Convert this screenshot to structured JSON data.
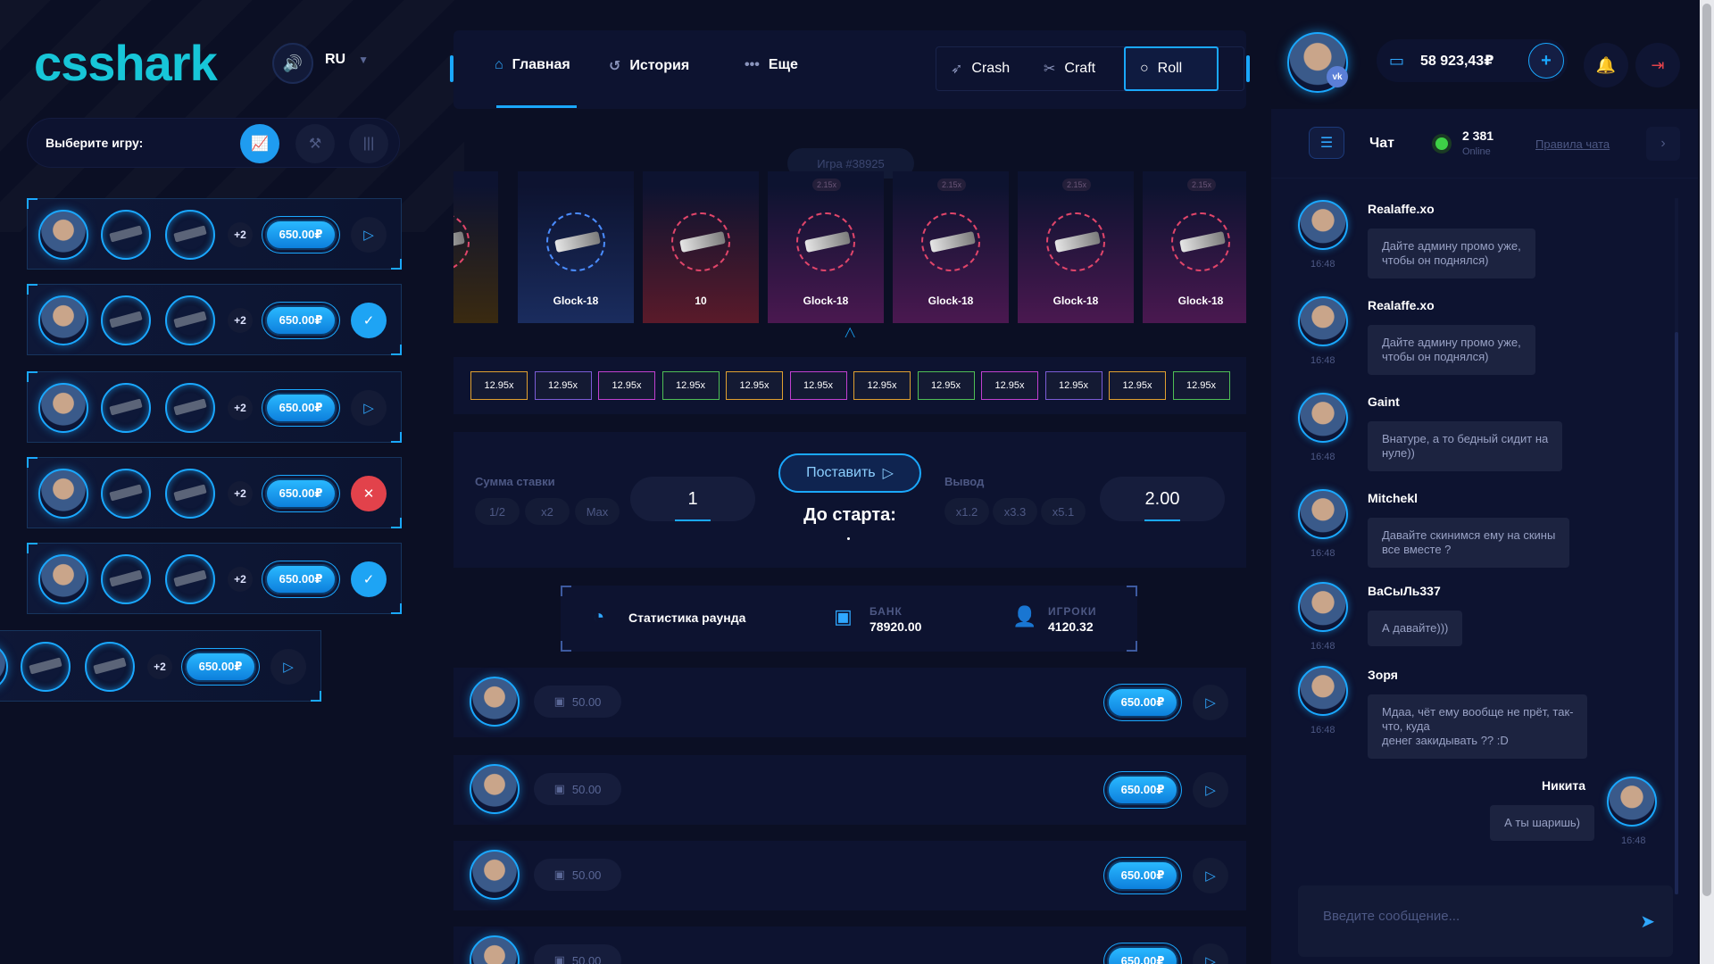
{
  "brand": {
    "logo": "csshark"
  },
  "language": {
    "selected": "RU"
  },
  "game_select": {
    "label": "Выберите игру:"
  },
  "colors": {
    "accent": "#1aa8ff",
    "danger": "#e2424b",
    "online": "#3ed147",
    "logo": "#17c6d8"
  },
  "bets": [
    {
      "extra": "+2",
      "amount": "650.00₽",
      "status": "play-icon"
    },
    {
      "extra": "+2",
      "amount": "650.00₽",
      "status": "check-icon"
    },
    {
      "extra": "+2",
      "amount": "650.00₽",
      "status": "play-icon"
    },
    {
      "extra": "+2",
      "amount": "650.00₽",
      "status": "cross-icon"
    },
    {
      "extra": "+2",
      "amount": "650.00₽",
      "status": "check-icon"
    },
    {
      "extra": "+2",
      "amount": "650.00₽",
      "status": "play-icon"
    }
  ],
  "nav": {
    "items": [
      {
        "label": "Главная",
        "icon": "home-icon",
        "active": true
      },
      {
        "label": "История",
        "icon": "history-icon",
        "active": false
      },
      {
        "label": "Еще",
        "icon": "dots-icon",
        "active": false
      }
    ],
    "modes": [
      {
        "label": "Crash",
        "icon": "rocket-icon",
        "active": false
      },
      {
        "label": "Craft",
        "icon": "tools-icon",
        "active": false
      },
      {
        "label": "Roll",
        "icon": "circle-icon",
        "active": true
      }
    ]
  },
  "roll": {
    "game_id": "Игра #38925",
    "cards": [
      {
        "name": "k-18",
        "mult": "",
        "color": "#3a2a10"
      },
      {
        "name": "Glock-18",
        "mult": "",
        "color": "#1a2c5e"
      },
      {
        "name": "10",
        "mult": "",
        "color": "#5a1a2a"
      },
      {
        "name": "Glock-18",
        "mult": "2.15x",
        "color": "#4a1850"
      },
      {
        "name": "Glock-18",
        "mult": "2.15x",
        "color": "#4a1850"
      },
      {
        "name": "Glock-18",
        "mult": "2.15x",
        "color": "#4a1850"
      },
      {
        "name": "Glock-18",
        "mult": "2.15x",
        "color": "#4a1850"
      }
    ]
  },
  "multipliers": [
    {
      "label": "12.95x",
      "color": "#e0a030"
    },
    {
      "label": "12.95x",
      "color": "#7b5cd6"
    },
    {
      "label": "12.95x",
      "color": "#c040d0"
    },
    {
      "label": "12.95x",
      "color": "#4fbf55"
    },
    {
      "label": "12.95x",
      "color": "#e0a030"
    },
    {
      "label": "12.95x",
      "color": "#c040d0"
    },
    {
      "label": "12.95x",
      "color": "#e0a030"
    },
    {
      "label": "12.95x",
      "color": "#4fbf55"
    },
    {
      "label": "12.95x",
      "color": "#c040d0"
    },
    {
      "label": "12.95x",
      "color": "#7b5cd6"
    },
    {
      "label": "12.95x",
      "color": "#e0a030"
    },
    {
      "label": "12.95x",
      "color": "#4fbf55"
    }
  ],
  "bet_panel": {
    "stake_label": "Сумма ставки",
    "stake_chips": [
      "1/2",
      "x2",
      "Max"
    ],
    "stake_value": "1",
    "place_label": "Поставить",
    "countdown_label": "До старта:",
    "cashout_label": "Вывод",
    "cashout_chips": [
      "x1.2",
      "x3.3",
      "x5.1"
    ],
    "cashout_value": "2.00"
  },
  "stats": {
    "title": "Статистика раунда",
    "bank_label": "БАНК",
    "bank_value": "78920.00",
    "players_label": "ИГРОКИ",
    "players_value": "4120.32"
  },
  "players": [
    {
      "bank": "50.00",
      "amount": "650.00₽"
    },
    {
      "bank": "50.00",
      "amount": "650.00₽"
    },
    {
      "bank": "50.00",
      "amount": "650.00₽"
    },
    {
      "bank": "50.00",
      "amount": "650.00₽"
    }
  ],
  "account": {
    "balance": "58 923,43₽",
    "vk": "vk"
  },
  "chat": {
    "title": "Чат",
    "online_count": "2 381",
    "online_label": "Online",
    "rules_link": "Правила чата",
    "input_placeholder": "Введите сообщение...",
    "messages": [
      {
        "author": "Realaffe.xo",
        "time": "16:48",
        "lines": [
          "Дайте админу промо уже,",
          "чтобы он поднялся)"
        ],
        "own": false
      },
      {
        "author": "Realaffe.xo",
        "time": "16:48",
        "lines": [
          "Дайте админу промо уже,",
          "чтобы он поднялся)"
        ],
        "own": false
      },
      {
        "author": "Gaint",
        "time": "16:48",
        "lines": [
          "Внатуре, а то бедный сидит на",
          "нуле))"
        ],
        "own": false
      },
      {
        "author": "Mitchekl",
        "time": "16:48",
        "lines": [
          "Давайте скинимся ему на скины",
          "все вместе ?"
        ],
        "own": false
      },
      {
        "author": "ВаСыЛь337",
        "time": "16:48",
        "lines": [
          "А давайте)))"
        ],
        "own": false
      },
      {
        "author": "Зоря",
        "time": "16:48",
        "lines": [
          "Мдаа, чёт ему вообще не прёт, так-",
          "что, куда",
          "денег закидывать ?? :D"
        ],
        "own": false
      },
      {
        "author": "Никита",
        "time": "16:48",
        "lines": [
          "А ты шаришь)"
        ],
        "own": true
      }
    ]
  }
}
